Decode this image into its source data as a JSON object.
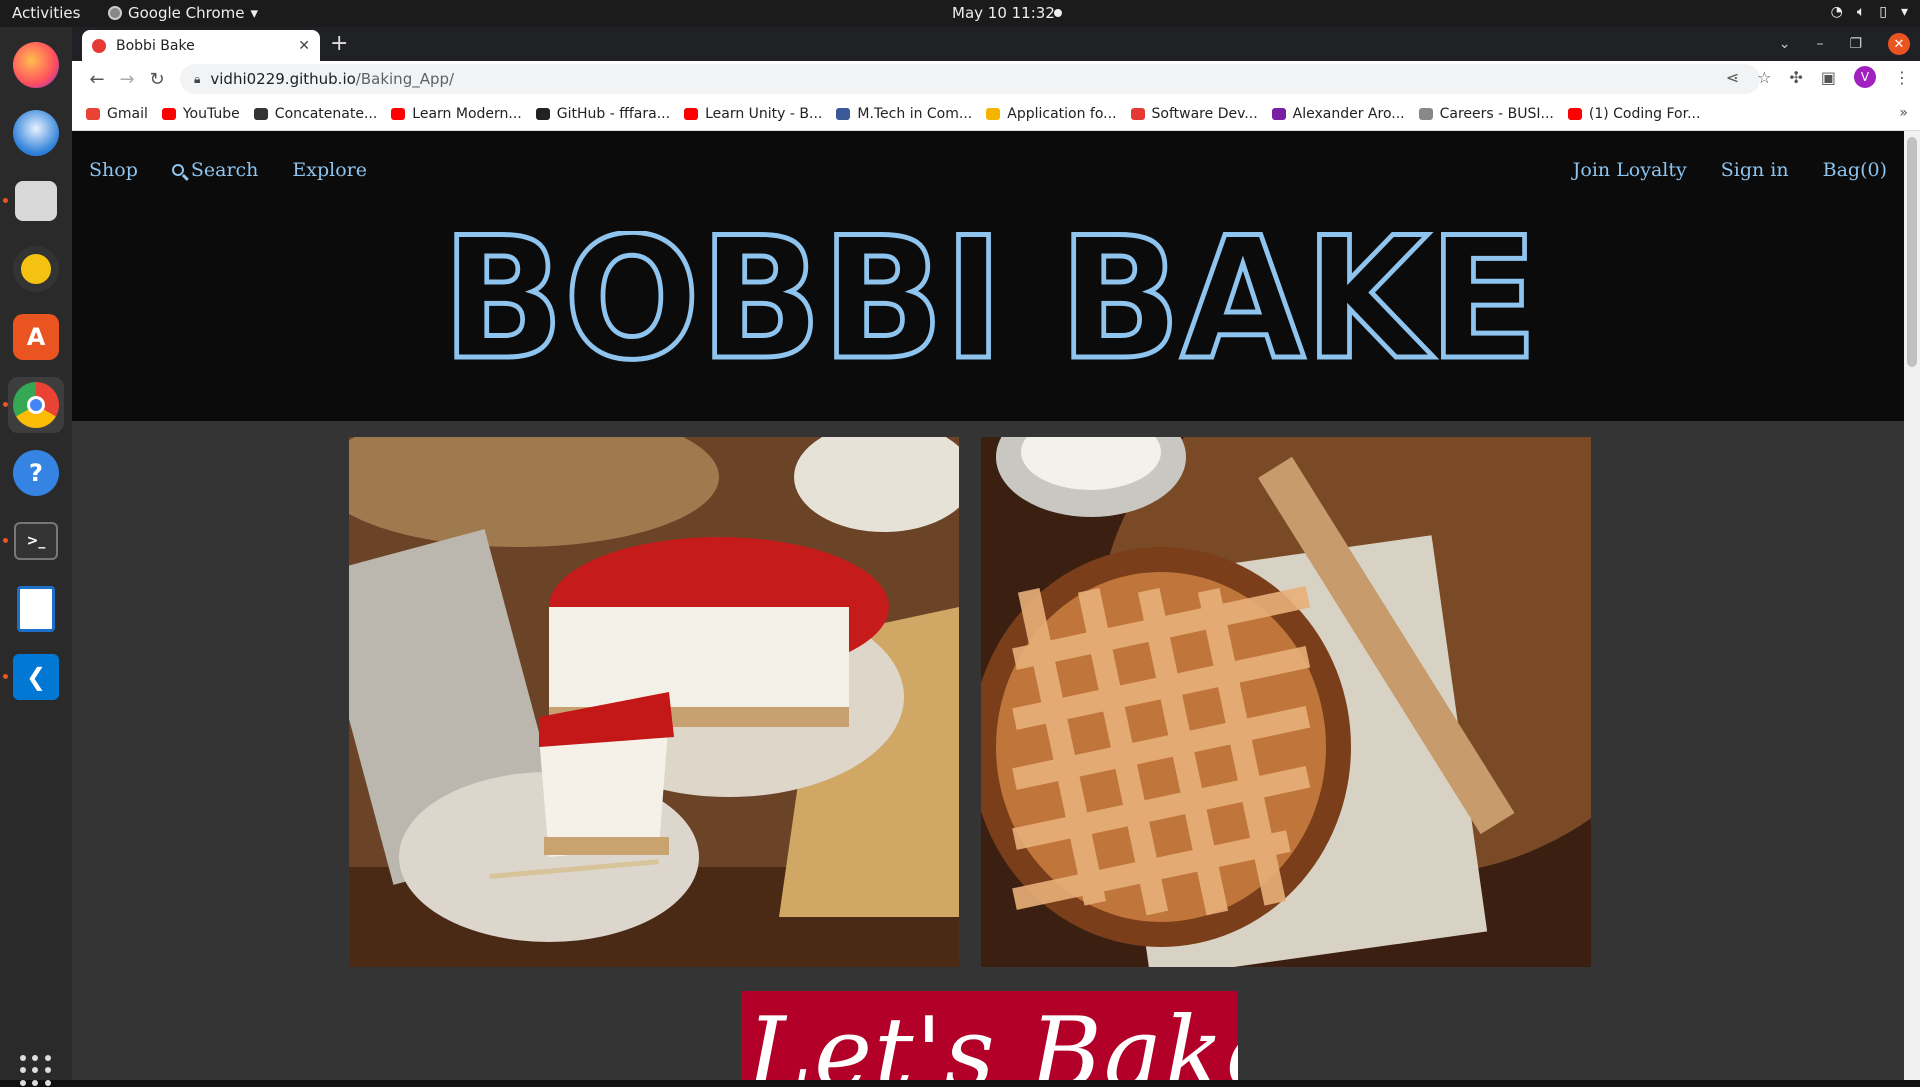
{
  "system": {
    "activities": "Activities",
    "app_name": "Google Chrome",
    "datetime": "May 10  11:32"
  },
  "dock": {
    "apps": [
      "firefox-icon",
      "thunderbird-icon",
      "files-icon",
      "rhythmbox-icon",
      "app-center-icon",
      "chrome-icon",
      "help-icon",
      "terminal-icon",
      "writer-icon",
      "vscode-icon"
    ]
  },
  "browser": {
    "tab_title": "Bobbi Bake",
    "url_host": "vidhi0229.github.io",
    "url_path": "/Baking_App/",
    "profile_initial": "V",
    "bookmarks": [
      {
        "label": "Gmail",
        "color": "#ea4335"
      },
      {
        "label": "YouTube",
        "color": "#ff0000"
      },
      {
        "label": "Concatenate...",
        "color": "#333333"
      },
      {
        "label": "Learn Modern...",
        "color": "#ff0000"
      },
      {
        "label": "GitHub - fffara...",
        "color": "#222222"
      },
      {
        "label": "Learn Unity - B...",
        "color": "#ff0000"
      },
      {
        "label": "M.Tech in Com...",
        "color": "#3b5998"
      },
      {
        "label": "Application fo...",
        "color": "#f4b400"
      },
      {
        "label": "Software Dev...",
        "color": "#e53935"
      },
      {
        "label": "Alexander Aro...",
        "color": "#7b1fa2"
      },
      {
        "label": "Careers - BUSI...",
        "color": "#888888"
      },
      {
        "label": "(1) Coding For...",
        "color": "#ff0000"
      }
    ]
  },
  "site": {
    "nav_left": {
      "shop": "Shop",
      "search": "Search",
      "explore": "Explore"
    },
    "nav_right": {
      "loyalty": "Join Loyalty",
      "signin": "Sign in",
      "bag": "Bag(0)"
    },
    "brand": "BOBBI BAKE",
    "accent_color": "#8ec4ee",
    "banner_text": "Let's Bake",
    "banner_color": "#b20028"
  }
}
